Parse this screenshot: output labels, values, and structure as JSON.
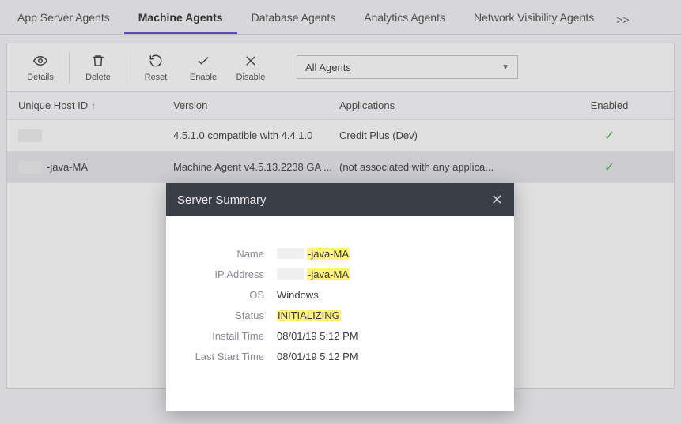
{
  "tabs": {
    "item0": "App Server Agents",
    "item1": "Machine Agents",
    "item2": "Database Agents",
    "item3": "Analytics Agents",
    "item4": "Network Visibility Agents",
    "more": ">>"
  },
  "toolbar": {
    "details": "Details",
    "delete": "Delete",
    "reset": "Reset",
    "enable": "Enable",
    "disable": "Disable",
    "filter_selected": "All Agents"
  },
  "columns": {
    "host": "Unique Host ID",
    "version": "Version",
    "apps": "Applications",
    "enabled": "Enabled"
  },
  "rows": [
    {
      "host_suffix": "",
      "version": "4.5.1.0 compatible with 4.4.1.0",
      "apps": "Credit Plus (Dev)",
      "enabled": true
    },
    {
      "host_suffix": "-java-MA",
      "version": "Machine Agent v4.5.13.2238 GA ...",
      "apps": "(not associated with any applica...",
      "enabled": true
    }
  ],
  "modal": {
    "title": "Server Summary",
    "labels": {
      "name": "Name",
      "ip": "IP Address",
      "os": "OS",
      "status": "Status",
      "install": "Install Time",
      "last_start": "Last Start Time"
    },
    "values": {
      "name_suffix": "-java-MA",
      "ip_suffix": "-java-MA",
      "os": "Windows",
      "status": "INITIALIZING",
      "install": "08/01/19 5:12 PM",
      "last_start": "08/01/19 5:12 PM"
    }
  }
}
